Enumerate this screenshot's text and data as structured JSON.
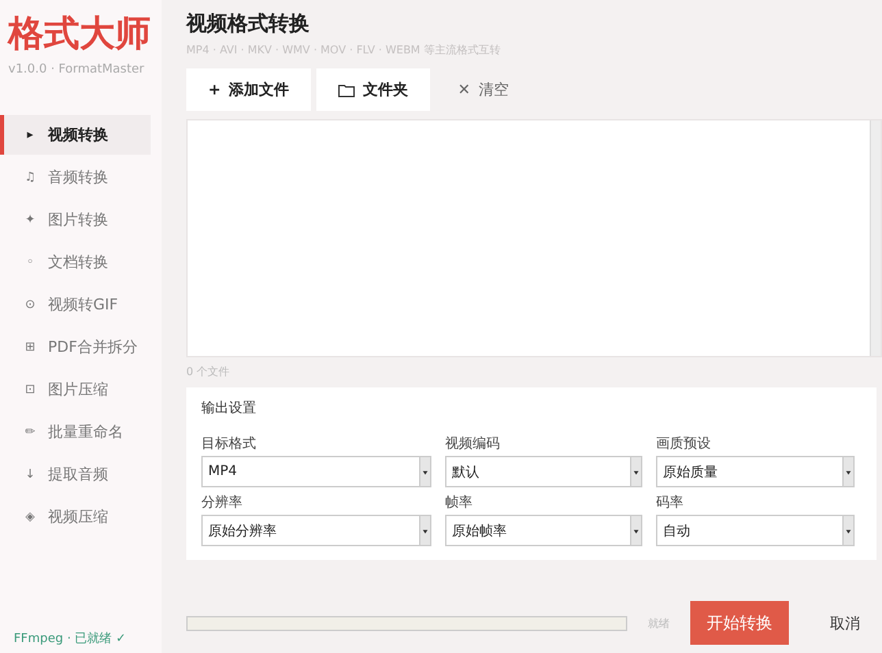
{
  "app": {
    "name": "格式大师",
    "version": "v1.0.0 · FormatMaster"
  },
  "sidebar": {
    "items": [
      {
        "icon": "▸",
        "label": "视频转换",
        "selected": true
      },
      {
        "icon": "♫",
        "label": "音频转换",
        "selected": false
      },
      {
        "icon": "✦",
        "label": "图片转换",
        "selected": false
      },
      {
        "icon": "◦",
        "label": "文档转换",
        "selected": false
      },
      {
        "icon": "⊙",
        "label": "视频转GIF",
        "selected": false
      },
      {
        "icon": "⊞",
        "label": "PDF合并拆分",
        "selected": false
      },
      {
        "icon": "⊡",
        "label": "图片压缩",
        "selected": false
      },
      {
        "icon": "✏",
        "label": "批量重命名",
        "selected": false
      },
      {
        "icon": "↓",
        "label": "提取音频",
        "selected": false
      },
      {
        "icon": "◈",
        "label": "视频压缩",
        "selected": false
      }
    ],
    "status": "FFmpeg · 已就绪 ✓"
  },
  "page": {
    "title": "视频格式转换",
    "subtitle": "MP4 · AVI · MKV · WMV · MOV · FLV · WEBM 等主流格式互转"
  },
  "toolbar": [
    {
      "kind": "add",
      "icon": "+",
      "label": "添加文件"
    },
    {
      "kind": "folder",
      "label": "文件夹"
    },
    {
      "kind": "clear",
      "icon": "✕",
      "label": "清空"
    }
  ],
  "file_count": "0 个文件",
  "settings": {
    "title": "输出设置",
    "fields": [
      {
        "label": "目标格式",
        "value": "MP4"
      },
      {
        "label": "视频编码",
        "value": "默认"
      },
      {
        "label": "画质预设",
        "value": "原始质量"
      },
      {
        "label": "分辨率",
        "value": "原始分辨率"
      },
      {
        "label": "帧率",
        "value": "原始帧率"
      },
      {
        "label": "码率",
        "value": "自动"
      }
    ]
  },
  "progress": {
    "status": "就绪"
  },
  "buttons": {
    "start": "开始转换",
    "cancel": "取消"
  }
}
